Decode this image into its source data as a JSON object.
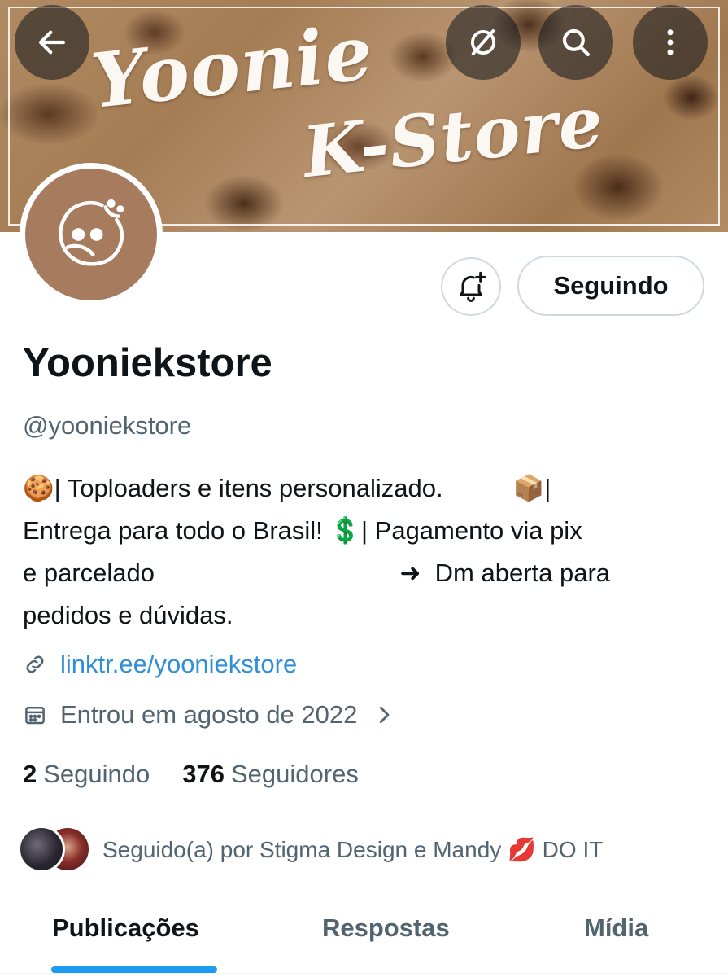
{
  "banner": {
    "line1": "Yoonie",
    "line2": "K-Store"
  },
  "top_buttons": {
    "back_icon": "arrow-left-icon",
    "grok_icon": "slash-circle-icon",
    "search_icon": "search-icon",
    "more_icon": "more-vertical-icon"
  },
  "profile": {
    "follow_button": "Seguindo",
    "name": "Yooniekstore",
    "handle": "@yooniekstore",
    "bio_lines": [
      "🍪| Toploaders e itens personalizado.          📦|",
      "Entrega para todo o Brasil! 💲| Pagamento via pix",
      "e parcelado                                   ➜  Dm aberta para",
      "pedidos e dúvidas."
    ],
    "link": "linktr.ee/yooniekstore",
    "joined": "Entrou em agosto de 2022"
  },
  "counts": {
    "following_num": "2",
    "following_label": "Seguindo",
    "followers_num": "376",
    "followers_label": "Seguidores"
  },
  "followed_by": "Seguido(a) por Stigma Design e Mandy 💋 DO IT",
  "tabs": [
    "Publicações",
    "Respostas",
    "Mídia"
  ],
  "colors": {
    "accent": "#1d9bf0",
    "secondary_text": "#536471",
    "avatar_bg": "#a77b5e"
  }
}
